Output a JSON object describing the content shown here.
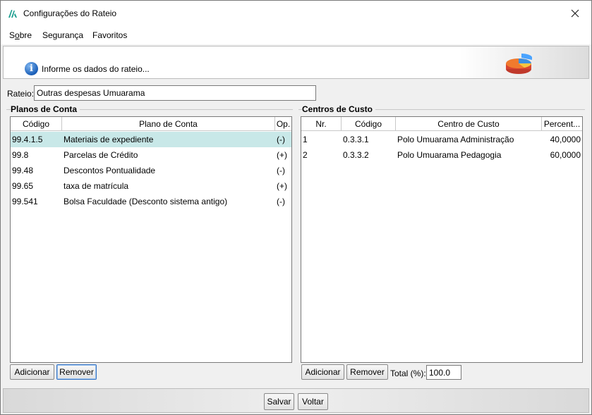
{
  "window": {
    "title": "Configurações do Rateio",
    "app_icon": "app-logo-icon",
    "close_icon": "close-icon"
  },
  "menu": {
    "items": [
      {
        "label": "Sobre",
        "mnemonic": "o"
      },
      {
        "label": "Segurança",
        "mnemonic": ""
      },
      {
        "label": "Favoritos",
        "mnemonic": ""
      }
    ]
  },
  "banner": {
    "text": "Informe os dados do rateio...",
    "icon": "info-icon",
    "graphic": "pie-chart-icon"
  },
  "rateio": {
    "label": "Rateio:",
    "value": "Outras despesas Umuarama"
  },
  "planos": {
    "group_title": "Planos de Conta",
    "columns": [
      "Código",
      "Plano de Conta",
      "Op."
    ],
    "rows": [
      {
        "codigo": "99.4.1.5",
        "plano": "Materiais de expediente",
        "op": "(-)",
        "selected": true
      },
      {
        "codigo": "99.8",
        "plano": "Parcelas de Crédito",
        "op": "(+)",
        "selected": false
      },
      {
        "codigo": "99.48",
        "plano": "Descontos Pontualidade",
        "op": "(-)",
        "selected": false
      },
      {
        "codigo": "99.65",
        "plano": "taxa de matrícula",
        "op": "(+)",
        "selected": false
      },
      {
        "codigo": "99.541",
        "plano": "Bolsa Faculdade (Desconto sistema antigo)",
        "op": "(-)",
        "selected": false
      }
    ],
    "buttons": {
      "add": "Adicionar",
      "remove": "Remover"
    }
  },
  "centros": {
    "group_title": "Centros de Custo",
    "columns": [
      "Nr.",
      "Código",
      "Centro de Custo",
      "Percent..."
    ],
    "rows": [
      {
        "nr": "1",
        "codigo": "0.3.3.1",
        "centro": "Polo Umuarama Administração",
        "percent": "40,0000"
      },
      {
        "nr": "2",
        "codigo": "0.3.3.2",
        "centro": "Polo Umuarama Pedagogia",
        "percent": "60,0000"
      }
    ],
    "buttons": {
      "add": "Adicionar",
      "remove": "Remover"
    },
    "total_label": "Total (%):",
    "total_value": "100.0"
  },
  "footer": {
    "save": "Salvar",
    "back": "Voltar"
  },
  "colors": {
    "selected_row": "#c8e8e8",
    "focus_border": "#3a75c4",
    "info_blue": "#1b5fb8"
  }
}
